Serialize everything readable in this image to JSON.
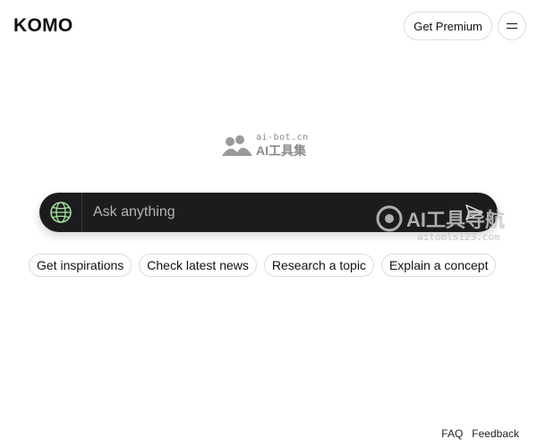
{
  "header": {
    "logo": "KOMO",
    "premium_label": "Get Premium"
  },
  "watermark_center": {
    "small": "ai-bot.cn",
    "big": "AI工具集"
  },
  "search": {
    "placeholder": "Ask anything"
  },
  "watermark_right": {
    "big": "AI工具导航",
    "url": "aitools123.com"
  },
  "chips": [
    {
      "label": "Get inspirations"
    },
    {
      "label": "Check latest news"
    },
    {
      "label": "Research a topic"
    },
    {
      "label": "Explain a concept"
    }
  ],
  "footer": {
    "faq": "FAQ",
    "feedback": "Feedback"
  },
  "colors": {
    "search_bg": "#1c1c1e",
    "globe_accent": "#a8e6a1"
  },
  "icons": [
    "globe-icon",
    "send-icon",
    "menu-icon"
  ]
}
